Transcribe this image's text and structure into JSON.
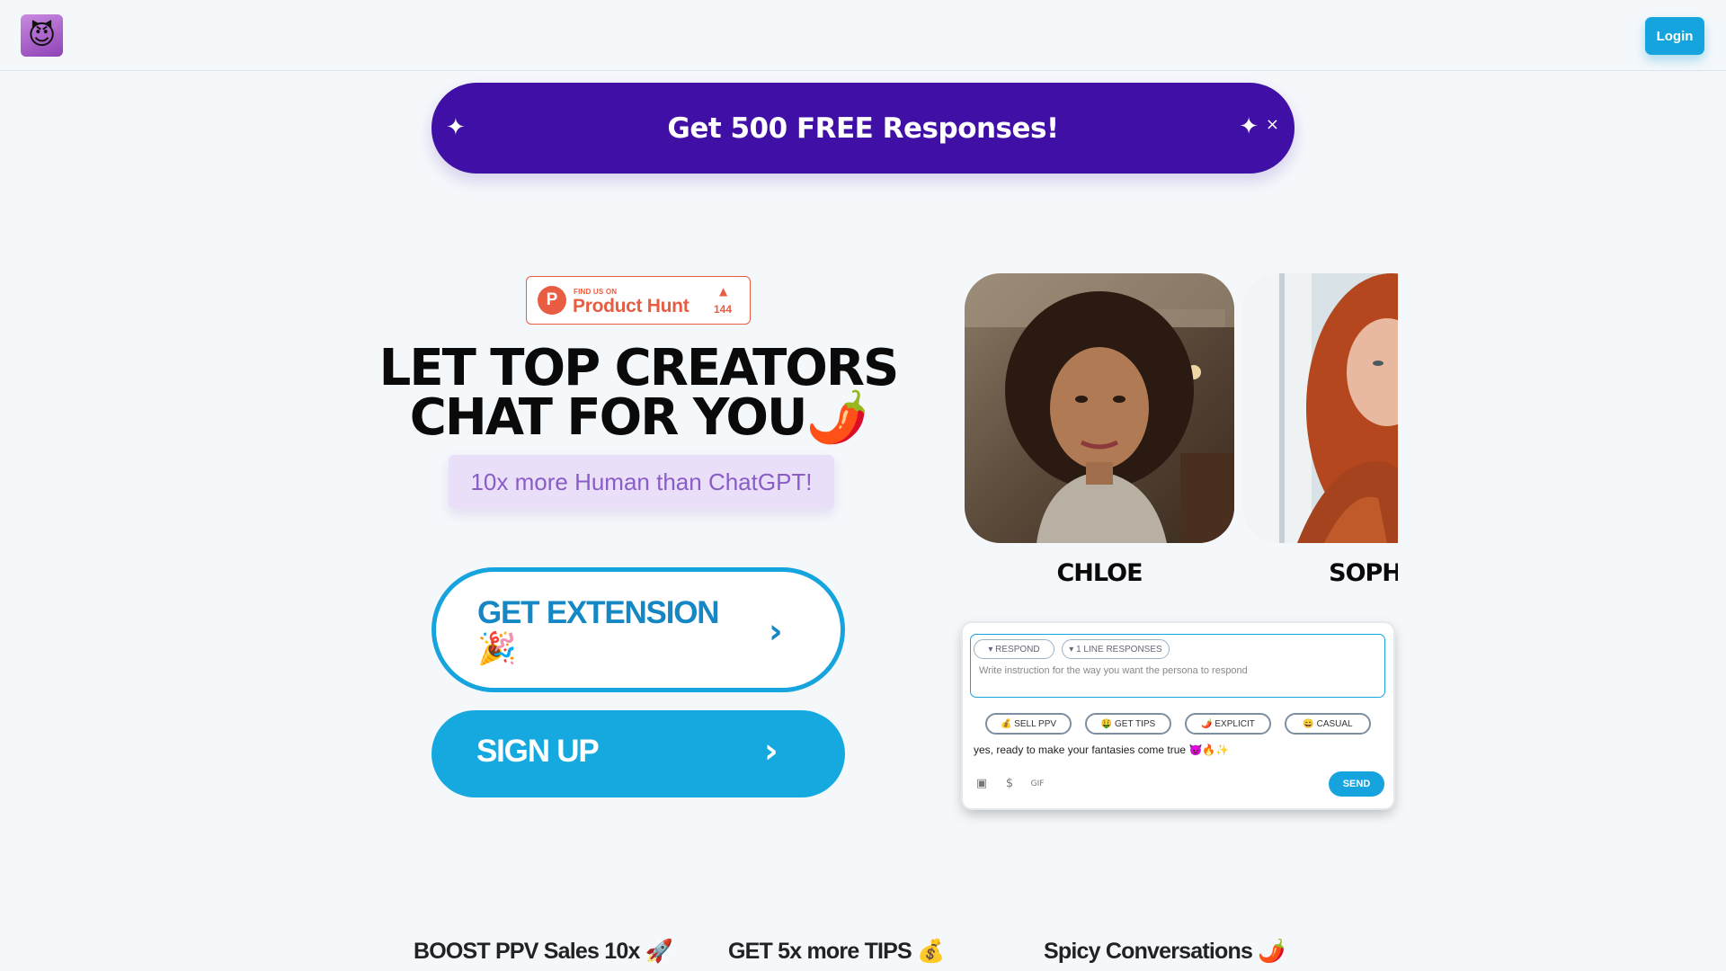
{
  "header": {
    "logo_emoji": "😈",
    "login_label": "Login"
  },
  "promo": {
    "text": "Get 500 FREE Responses!",
    "spark_icon": "✦",
    "close_icon": "×"
  },
  "product_hunt": {
    "logo_letter": "P",
    "find_us": "FIND US ON",
    "name": "Product Hunt",
    "arrow": "▲",
    "count": "144"
  },
  "hero": {
    "headline_line1": "LET TOP CREATORS",
    "headline_line2": "CHAT FOR YOU🌶️",
    "subtag": "10x more Human than ChatGPT!"
  },
  "cta": {
    "extension_label": "GET EXTENSION 🎉",
    "signup_label": "SIGN UP",
    "chevron": "›"
  },
  "personas": [
    {
      "name": "CHLOE"
    },
    {
      "name": "SOPHIA"
    }
  ],
  "chat": {
    "respond_label": "▾ RESPOND",
    "lines_label": "▾ 1 LINE RESPONSES",
    "placeholder": "Write instruction for the way you want the persona to respond",
    "quick": [
      "💰 SELL PPV",
      "🤑 GET TIPS",
      "🌶️ EXPLICIT",
      "😄 CASUAL"
    ],
    "message": "yes, ready to make your fantasies come true 😈🔥✨",
    "send_label": "SEND",
    "icons": [
      "image-icon",
      "dollar-icon",
      "gif-icon"
    ]
  },
  "features": [
    "BOOST PPV Sales 10x 🚀",
    "GET 5x more TIPS 💰",
    "Spicy Conversations 🌶️"
  ],
  "colors": {
    "accent": "#16a4de",
    "promo": "#3f0fa6",
    "product_hunt": "#e85c42",
    "subtag_bg": "#eadff8"
  }
}
